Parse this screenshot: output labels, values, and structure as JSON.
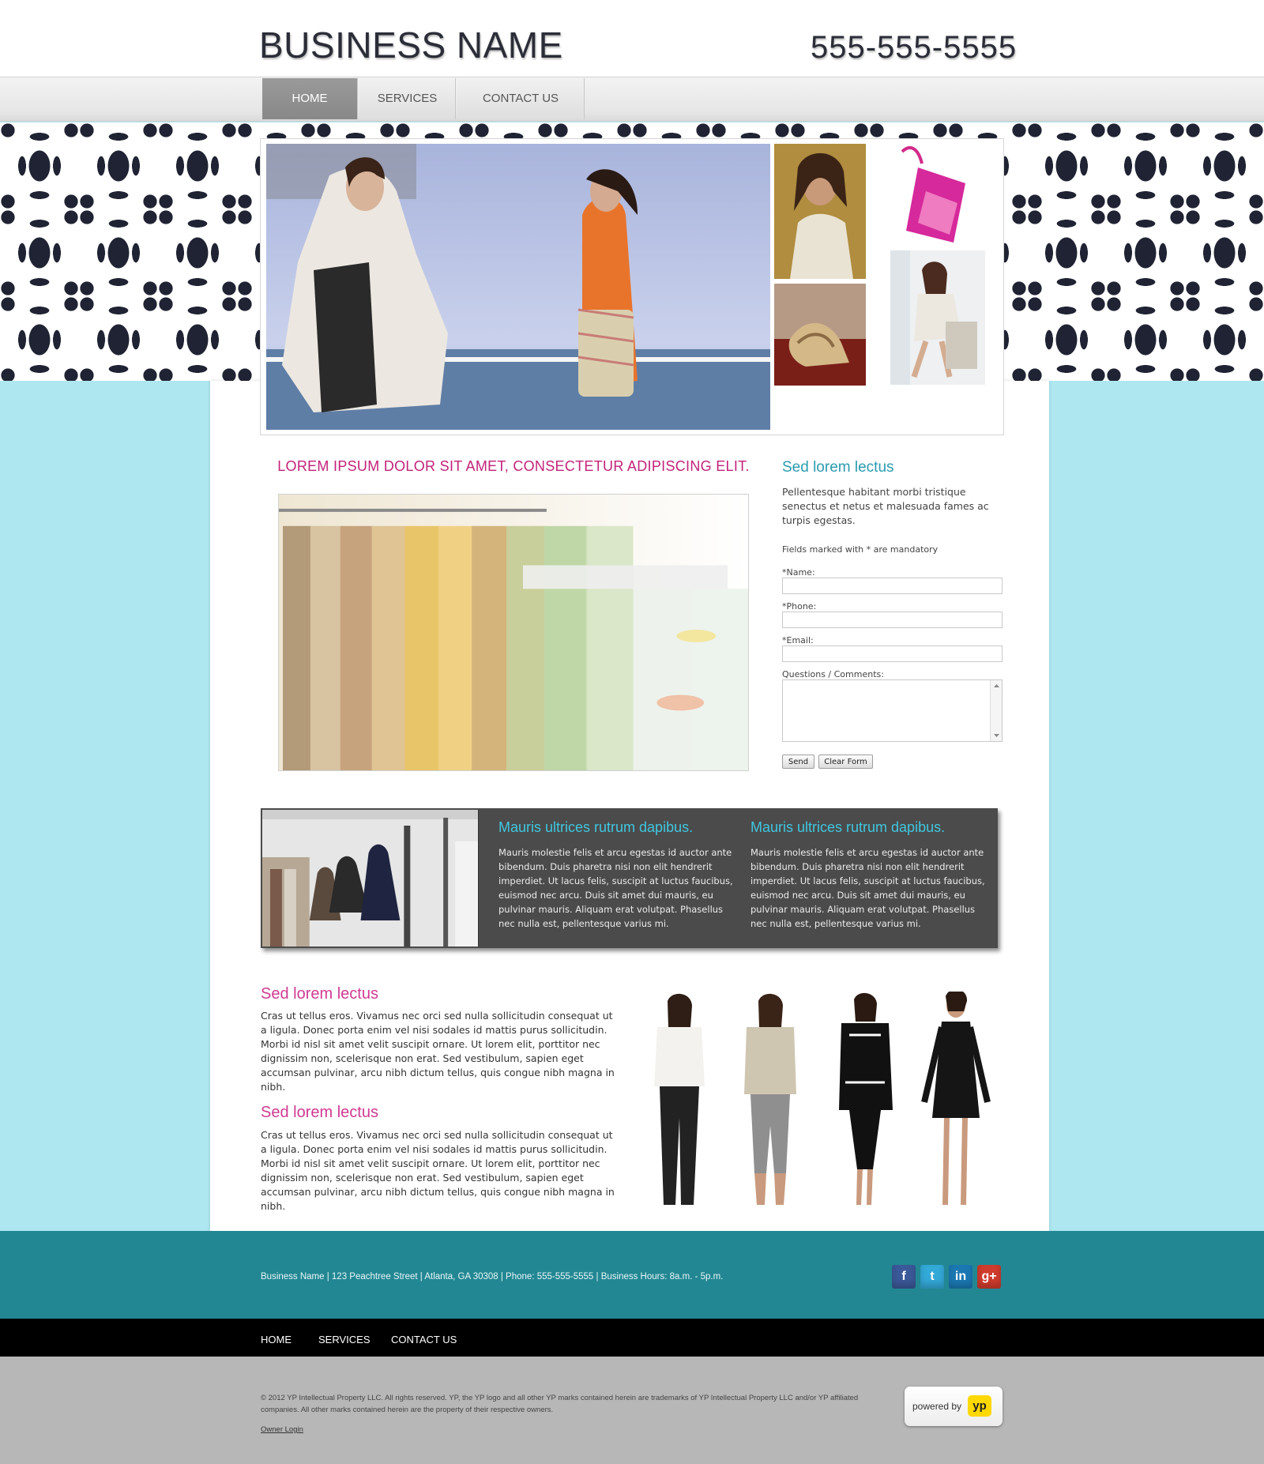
{
  "header": {
    "business_name": "BUSINESS NAME",
    "phone": "555-555-5555"
  },
  "nav": [
    {
      "label": "HOME",
      "active": true
    },
    {
      "label": "SERVICES",
      "active": false
    },
    {
      "label": "CONTACT US",
      "active": false
    }
  ],
  "main": {
    "headline": "LOREM IPSUM DOLOR SIT AMET, CONSECTETUR ADIPISCING ELIT."
  },
  "form": {
    "title": "Sed lorem lectus",
    "description": "Pellentesque habitant morbi tristique senectus et netus et malesuada fames ac turpis egestas.",
    "note": "Fields marked with * are mandatory",
    "name_label": "*Name:",
    "phone_label": "*Phone:",
    "email_label": "*Email:",
    "comments_label": "Questions / Comments:",
    "name_value": "",
    "phone_value": "",
    "email_value": "",
    "comments_value": "",
    "send_label": "Send",
    "clear_label": "Clear Form"
  },
  "feature": {
    "col1": {
      "title": "Mauris ultrices rutrum dapibus.",
      "text": "Mauris molestie felis et arcu egestas id auctor ante bibendum. Duis pharetra nisi non elit hendrerit imperdiet. Ut lacus felis, suscipit at luctus faucibus, euismod nec arcu. Duis sit amet dui mauris, eu pulvinar mauris. Aliquam erat volutpat. Phasellus nec nulla est, pellentesque varius mi."
    },
    "col2": {
      "title": "Mauris ultrices rutrum dapibus.",
      "text": "Mauris molestie felis et arcu egestas id auctor ante bibendum. Duis pharetra nisi non elit hendrerit imperdiet. Ut lacus felis, suscipit at luctus faucibus, euismod nec arcu. Duis sit amet dui mauris, eu pulvinar mauris. Aliquam erat volutpat. Phasellus nec nulla est, pellentesque varius mi."
    }
  },
  "sections": [
    {
      "title": "Sed lorem lectus",
      "text": "Cras ut tellus eros. Vivamus nec orci sed nulla sollicitudin consequat ut a ligula. Donec porta enim vel nisi sodales id mattis purus sollicitudin. Morbi id nisl sit amet velit suscipit ornare. Ut lorem elit, porttitor nec dignissim non, scelerisque non erat. Sed vestibulum, sapien eget accumsan pulvinar, arcu nibh dictum tellus, quis congue nibh magna in nibh."
    },
    {
      "title": "Sed lorem lectus",
      "text": "Cras ut tellus eros. Vivamus nec orci sed nulla sollicitudin consequat ut a ligula. Donec porta enim vel nisi sodales id mattis purus sollicitudin. Morbi id nisl sit amet velit suscipit ornare. Ut lorem elit, porttitor nec dignissim non, scelerisque non erat. Sed vestibulum, sapien eget accumsan pulvinar, arcu nibh dictum tellus, quis congue nibh magna in nibh."
    }
  ],
  "footer": {
    "address": "Business Name  |  123 Peachtree Street  |  Atlanta, GA 30308  |  Phone: 555-555-5555  |  Business Hours: 8a.m. - 5p.m.",
    "social": [
      {
        "icon": "facebook-icon",
        "glyph": "f",
        "color": "#3b5998"
      },
      {
        "icon": "twitter-icon",
        "glyph": "t",
        "color": "#33a9d8"
      },
      {
        "icon": "linkedin-icon",
        "glyph": "in",
        "color": "#1b78b3"
      },
      {
        "icon": "google-plus-icon",
        "glyph": "g+",
        "color": "#cf3b2c"
      }
    ],
    "nav": [
      "HOME",
      "SERVICES",
      "CONTACT US"
    ],
    "legal": "© 2012  YP Intellectual Property LLC. All rights reserved. YP, the YP logo and all other YP marks contained herein are trademarks of YP Intellectual Property LLC and/or YP affiliated companies. All other marks contained herein are the property of their respective owners.",
    "owner_login": "Owner Login",
    "powered_by": "powered by",
    "yp_logo": "yp"
  },
  "colors": {
    "page_bg": "#aee7f0",
    "accent_pink": "#c3227a",
    "accent_teal": "#2a9bb0",
    "footer_teal": "#228793",
    "feature_bg": "#4b4b4b"
  }
}
